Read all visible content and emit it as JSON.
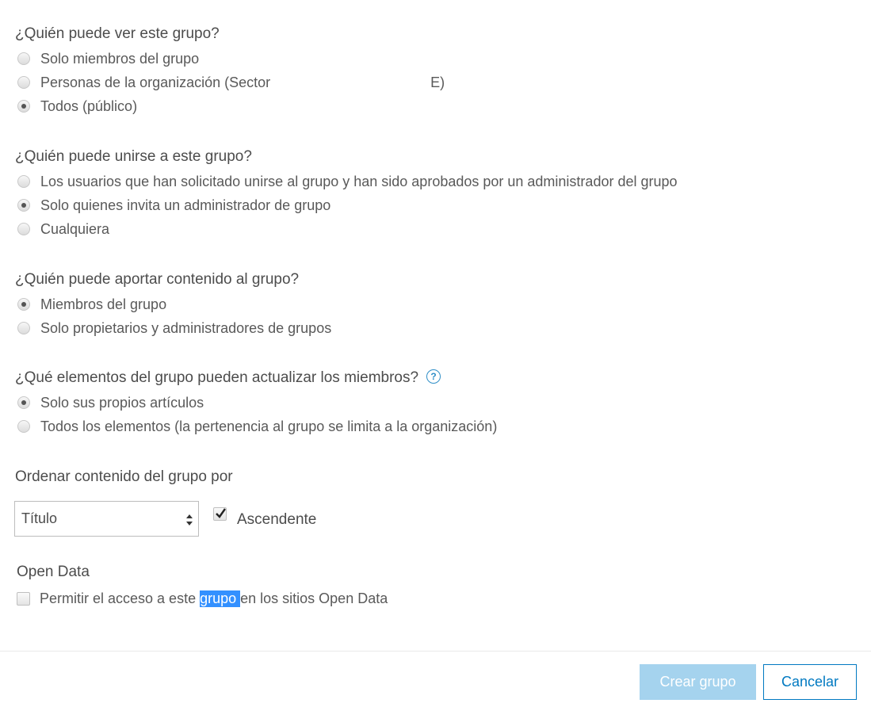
{
  "visibility": {
    "title": "¿Quién puede ver este grupo?",
    "options": [
      {
        "label": "Solo miembros del grupo",
        "checked": false
      },
      {
        "label": "Personas de la organización (Sector",
        "suffix": "E)",
        "checked": false
      },
      {
        "label": "Todos (público)",
        "checked": true
      }
    ]
  },
  "join": {
    "title": "¿Quién puede unirse a este grupo?",
    "options": [
      {
        "label": "Los usuarios que han solicitado unirse al grupo y han sido aprobados por un administrador del grupo",
        "checked": false
      },
      {
        "label": "Solo quienes invita un administrador de grupo",
        "checked": true
      },
      {
        "label": "Cualquiera",
        "checked": false
      }
    ]
  },
  "contribute": {
    "title": "¿Quién puede aportar contenido al grupo?",
    "options": [
      {
        "label": "Miembros del grupo",
        "checked": true
      },
      {
        "label": "Solo propietarios y administradores de grupos",
        "checked": false
      }
    ]
  },
  "update": {
    "title": "¿Qué elementos del grupo pueden actualizar los miembros?",
    "help_icon": "question-circle-icon",
    "options": [
      {
        "label": "Solo sus propios artículos",
        "checked": true
      },
      {
        "label": "Todos los elementos (la pertenencia al grupo se limita a la organización)",
        "checked": false
      }
    ]
  },
  "sort": {
    "title": "Ordenar contenido del grupo por",
    "selected": "Título",
    "ascending_label": "Ascendente",
    "ascending_checked": true
  },
  "open_data": {
    "title": "Open Data",
    "label_before": "Permitir el acceso a este ",
    "label_highlight": "grupo ",
    "label_after": "en los sitios Open Data",
    "checked": false
  },
  "footer": {
    "create_label": "Crear grupo",
    "cancel_label": "Cancelar"
  },
  "colors": {
    "accent": "#0079c1",
    "create_button_disabled": "#a5d3ee",
    "text_selection": "#3390ff",
    "help_icon": "#2f8ec7"
  }
}
